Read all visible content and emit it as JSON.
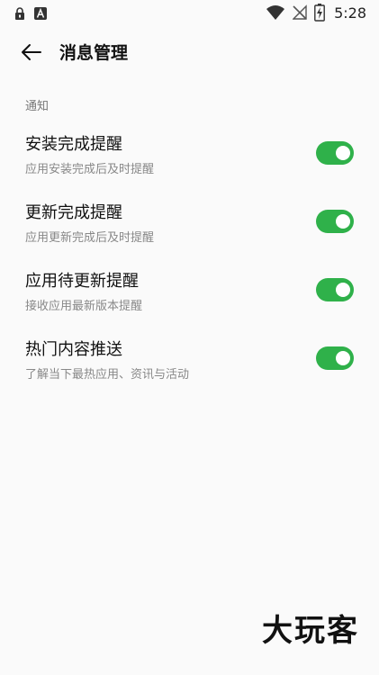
{
  "status_bar": {
    "time": "5:28",
    "icons": [
      "lock-icon",
      "a-logo-icon",
      "wifi-icon",
      "no-signal-icon",
      "battery-charging-icon"
    ]
  },
  "header": {
    "title": "消息管理",
    "back_icon": "arrow-left-icon"
  },
  "section": {
    "title": "通知"
  },
  "settings": [
    {
      "title": "安装完成提醒",
      "subtitle": "应用安装完成后及时提醒",
      "enabled": true
    },
    {
      "title": "更新完成提醒",
      "subtitle": "应用更新完成后及时提醒",
      "enabled": true
    },
    {
      "title": "应用待更新提醒",
      "subtitle": "接收应用最新版本提醒",
      "enabled": true
    },
    {
      "title": "热门内容推送",
      "subtitle": "了解当下最热应用、资讯与活动",
      "enabled": true
    }
  ],
  "watermark": "大玩客",
  "colors": {
    "accent": "#2fb14a",
    "background": "#fafafa",
    "subtitle": "#888888",
    "section": "#777777"
  }
}
